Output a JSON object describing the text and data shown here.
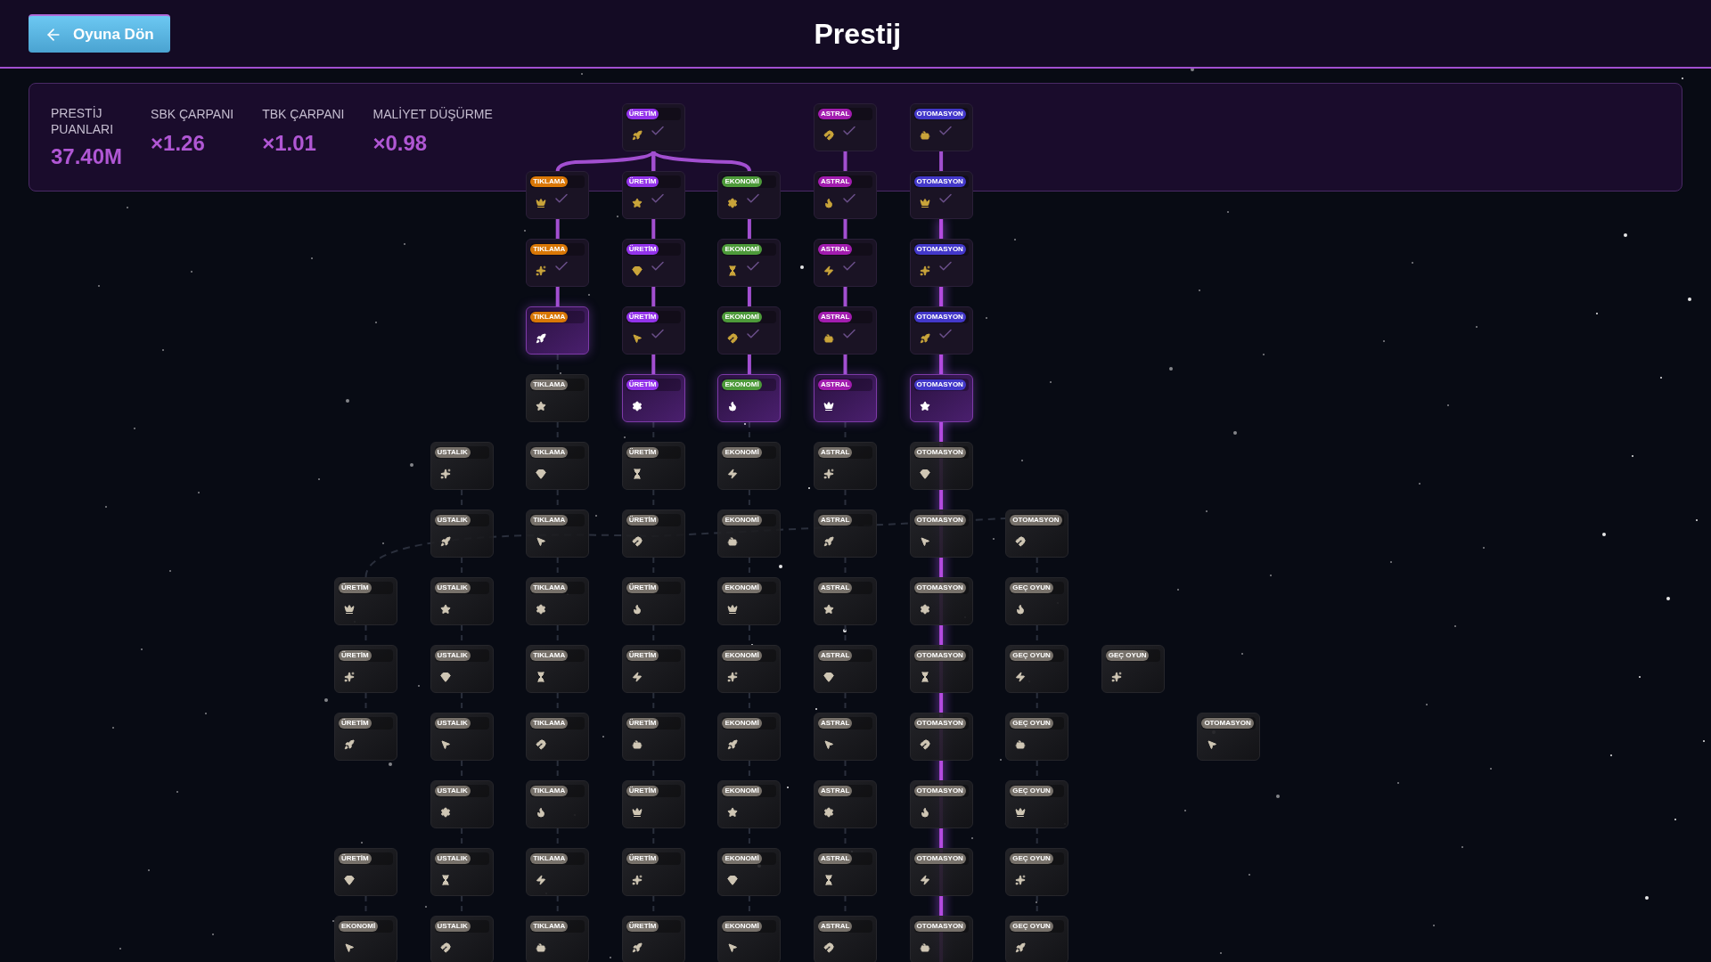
{
  "header": {
    "back_button": "Oyuna Dön",
    "title": "Prestij"
  },
  "stats": [
    {
      "label": "PRESTİJ PUANLARI",
      "value": "37.40M"
    },
    {
      "label": "SBK ÇARPANI",
      "value": "×1.26"
    },
    {
      "label": "TBK ÇARPANI",
      "value": "×1.01"
    },
    {
      "label": "MALİYET DÜŞÜRME",
      "value": "×0.98"
    }
  ],
  "tree": {
    "rows": [
      {
        "slots": [
          {
            "kind": "empty"
          },
          {
            "kind": "empty"
          },
          {
            "kind": "empty"
          },
          {
            "kind": "node",
            "badge": "ÜRETİM",
            "purchased": true,
            "locked": false,
            "color": "#9333ea"
          },
          {
            "kind": "empty"
          },
          {
            "kind": "node",
            "badge": "ASTRAL",
            "purchased": true,
            "locked": false,
            "color": "#a21caf"
          },
          {
            "kind": "node",
            "badge": "OTOMASYON",
            "purchased": true,
            "locked": false,
            "color": "#4338ca"
          }
        ]
      },
      {
        "slots": [
          {
            "kind": "empty"
          },
          {
            "kind": "empty"
          },
          {
            "kind": "node",
            "badge": "TIKLAMA",
            "purchased": true,
            "locked": false,
            "color": "#d97706"
          },
          {
            "kind": "node",
            "badge": "ÜRETİM",
            "purchased": true,
            "locked": false,
            "color": "#9333ea"
          },
          {
            "kind": "node",
            "badge": "EKONOMİ",
            "purchased": true,
            "locked": false,
            "color": "#4d9a3a"
          },
          {
            "kind": "node",
            "badge": "ASTRAL",
            "purchased": true,
            "locked": false,
            "color": "#a21caf"
          },
          {
            "kind": "node",
            "badge": "OTOMASYON",
            "purchased": true,
            "locked": false,
            "color": "#4338ca"
          }
        ]
      },
      {
        "slots": [
          {
            "kind": "empty"
          },
          {
            "kind": "empty"
          },
          {
            "kind": "node",
            "badge": "TIKLAMA",
            "purchased": true,
            "locked": false,
            "color": "#d97706"
          },
          {
            "kind": "node",
            "badge": "ÜRETİM",
            "purchased": true,
            "locked": false,
            "color": "#9333ea"
          },
          {
            "kind": "node",
            "badge": "EKONOMİ",
            "purchased": true,
            "locked": false,
            "color": "#4d9a3a"
          },
          {
            "kind": "node",
            "badge": "ASTRAL",
            "purchased": true,
            "locked": false,
            "color": "#a21caf"
          },
          {
            "kind": "node",
            "badge": "OTOMASYON",
            "purchased": true,
            "locked": false,
            "color": "#4338ca"
          }
        ]
      },
      {
        "slots": [
          {
            "kind": "empty"
          },
          {
            "kind": "empty"
          },
          {
            "kind": "node",
            "badge": "TIKLAMA",
            "purchased": false,
            "locked": false,
            "color": "#d97706"
          },
          {
            "kind": "node",
            "badge": "ÜRETİM",
            "purchased": true,
            "locked": false,
            "color": "#9333ea"
          },
          {
            "kind": "node",
            "badge": "EKONOMİ",
            "purchased": true,
            "locked": false,
            "color": "#4d9a3a"
          },
          {
            "kind": "node",
            "badge": "ASTRAL",
            "purchased": true,
            "locked": false,
            "color": "#a21caf"
          },
          {
            "kind": "node",
            "badge": "OTOMASYON",
            "purchased": true,
            "locked": false,
            "color": "#4338ca"
          }
        ]
      },
      {
        "slots": [
          {
            "kind": "empty"
          },
          {
            "kind": "empty"
          },
          {
            "kind": "node",
            "badge": "TIKLAMA",
            "purchased": false,
            "locked": true
          },
          {
            "kind": "node",
            "badge": "ÜRETİM",
            "purchased": false,
            "locked": false,
            "color": "#9333ea"
          },
          {
            "kind": "node",
            "badge": "EKONOMİ",
            "purchased": false,
            "locked": false,
            "color": "#4d9a3a"
          },
          {
            "kind": "node",
            "badge": "ASTRAL",
            "purchased": false,
            "locked": false,
            "color": "#a21caf"
          },
          {
            "kind": "node",
            "badge": "OTOMASYON",
            "purchased": false,
            "locked": false,
            "color": "#4338ca"
          }
        ]
      },
      {
        "slots": [
          {
            "kind": "empty"
          },
          {
            "kind": "node",
            "badge": "USTALIK",
            "purchased": false,
            "locked": true
          },
          {
            "kind": "node",
            "badge": "TIKLAMA",
            "purchased": false,
            "locked": true
          },
          {
            "kind": "node",
            "badge": "ÜRETİM",
            "purchased": false,
            "locked": true
          },
          {
            "kind": "node",
            "badge": "EKONOMİ",
            "purchased": false,
            "locked": true
          },
          {
            "kind": "node",
            "badge": "ASTRAL",
            "purchased": false,
            "locked": true
          },
          {
            "kind": "node",
            "badge": "OTOMASYON",
            "purchased": false,
            "locked": true
          }
        ]
      },
      {
        "slots": [
          {
            "kind": "empty"
          },
          {
            "kind": "node",
            "badge": "USTALIK",
            "purchased": false,
            "locked": true
          },
          {
            "kind": "node",
            "badge": "TIKLAMA",
            "purchased": false,
            "locked": true
          },
          {
            "kind": "node",
            "badge": "ÜRETİM",
            "purchased": false,
            "locked": true
          },
          {
            "kind": "node",
            "badge": "EKONOMİ",
            "purchased": false,
            "locked": true
          },
          {
            "kind": "node",
            "badge": "ASTRAL",
            "purchased": false,
            "locked": true
          },
          {
            "kind": "node",
            "badge": "OTOMASYON",
            "purchased": false,
            "locked": true
          },
          {
            "kind": "node",
            "badge": "OTOMASYON",
            "purchased": false,
            "locked": true
          }
        ]
      },
      {
        "slots": [
          {
            "kind": "node",
            "badge": "ÜRETİM",
            "purchased": false,
            "locked": true
          },
          {
            "kind": "node",
            "badge": "USTALIK",
            "purchased": false,
            "locked": true
          },
          {
            "kind": "node",
            "badge": "TIKLAMA",
            "purchased": false,
            "locked": true
          },
          {
            "kind": "node",
            "badge": "ÜRETİM",
            "purchased": false,
            "locked": true
          },
          {
            "kind": "node",
            "badge": "EKONOMİ",
            "purchased": false,
            "locked": true
          },
          {
            "kind": "node",
            "badge": "ASTRAL",
            "purchased": false,
            "locked": true
          },
          {
            "kind": "node",
            "badge": "OTOMASYON",
            "purchased": false,
            "locked": true
          },
          {
            "kind": "node",
            "badge": "GEÇ OYUN",
            "purchased": false,
            "locked": true
          }
        ]
      },
      {
        "slots": [
          {
            "kind": "node",
            "badge": "ÜRETİM",
            "purchased": false,
            "locked": true
          },
          {
            "kind": "node",
            "badge": "USTALIK",
            "purchased": false,
            "locked": true
          },
          {
            "kind": "node",
            "badge": "TIKLAMA",
            "purchased": false,
            "locked": true
          },
          {
            "kind": "node",
            "badge": "ÜRETİM",
            "purchased": false,
            "locked": true
          },
          {
            "kind": "node",
            "badge": "EKONOMİ",
            "purchased": false,
            "locked": true
          },
          {
            "kind": "node",
            "badge": "ASTRAL",
            "purchased": false,
            "locked": true
          },
          {
            "kind": "node",
            "badge": "OTOMASYON",
            "purchased": false,
            "locked": true
          },
          {
            "kind": "node",
            "badge": "GEÇ OYUN",
            "purchased": false,
            "locked": true
          },
          {
            "kind": "node",
            "badge": "GEÇ OYUN",
            "purchased": false,
            "locked": true
          }
        ]
      },
      {
        "slots": [
          {
            "kind": "node",
            "badge": "ÜRETİM",
            "purchased": false,
            "locked": true
          },
          {
            "kind": "node",
            "badge": "USTALIK",
            "purchased": false,
            "locked": true
          },
          {
            "kind": "node",
            "badge": "TIKLAMA",
            "purchased": false,
            "locked": true
          },
          {
            "kind": "node",
            "badge": "ÜRETİM",
            "purchased": false,
            "locked": true
          },
          {
            "kind": "node",
            "badge": "EKONOMİ",
            "purchased": false,
            "locked": true
          },
          {
            "kind": "node",
            "badge": "ASTRAL",
            "purchased": false,
            "locked": true
          },
          {
            "kind": "node",
            "badge": "OTOMASYON",
            "purchased": false,
            "locked": true
          },
          {
            "kind": "node",
            "badge": "GEÇ OYUN",
            "purchased": false,
            "locked": true
          },
          {
            "kind": "empty"
          },
          {
            "kind": "node",
            "badge": "OTOMASYON",
            "purchased": false,
            "locked": true
          }
        ]
      },
      {
        "slots": [
          {
            "kind": "empty"
          },
          {
            "kind": "node",
            "badge": "USTALIK",
            "purchased": false,
            "locked": true
          },
          {
            "kind": "node",
            "badge": "TIKLAMA",
            "purchased": false,
            "locked": true
          },
          {
            "kind": "node",
            "badge": "ÜRETİM",
            "purchased": false,
            "locked": true
          },
          {
            "kind": "node",
            "badge": "EKONOMİ",
            "purchased": false,
            "locked": true
          },
          {
            "kind": "node",
            "badge": "ASTRAL",
            "purchased": false,
            "locked": true
          },
          {
            "kind": "node",
            "badge": "OTOMASYON",
            "purchased": false,
            "locked": true
          },
          {
            "kind": "node",
            "badge": "GEÇ OYUN",
            "purchased": false,
            "locked": true
          }
        ]
      },
      {
        "slots": [
          {
            "kind": "node",
            "badge": "ÜRETİM",
            "purchased": false,
            "locked": true
          },
          {
            "kind": "node",
            "badge": "USTALIK",
            "purchased": false,
            "locked": true
          },
          {
            "kind": "node",
            "badge": "TIKLAMA",
            "purchased": false,
            "locked": true
          },
          {
            "kind": "node",
            "badge": "ÜRETİM",
            "purchased": false,
            "locked": true
          },
          {
            "kind": "node",
            "badge": "EKONOMİ",
            "purchased": false,
            "locked": true
          },
          {
            "kind": "node",
            "badge": "ASTRAL",
            "purchased": false,
            "locked": true
          },
          {
            "kind": "node",
            "badge": "OTOMASYON",
            "purchased": false,
            "locked": true
          },
          {
            "kind": "node",
            "badge": "GEÇ OYUN",
            "purchased": false,
            "locked": true
          }
        ]
      },
      {
        "slots": [
          {
            "kind": "node",
            "badge": "EKONOMİ",
            "purchased": false,
            "locked": true
          },
          {
            "kind": "node",
            "badge": "USTALIK",
            "purchased": false,
            "locked": true
          },
          {
            "kind": "node",
            "badge": "TIKLAMA",
            "purchased": false,
            "locked": true
          },
          {
            "kind": "node",
            "badge": "ÜRETİM",
            "purchased": false,
            "locked": true
          },
          {
            "kind": "node",
            "badge": "EKONOMİ",
            "purchased": false,
            "locked": true
          },
          {
            "kind": "node",
            "badge": "ASTRAL",
            "purchased": false,
            "locked": true
          },
          {
            "kind": "node",
            "badge": "OTOMASYON",
            "purchased": false,
            "locked": true
          },
          {
            "kind": "node",
            "badge": "GEÇ OYUN",
            "purchased": false,
            "locked": true
          }
        ]
      }
    ]
  }
}
